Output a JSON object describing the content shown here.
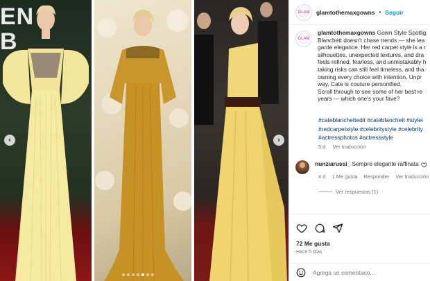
{
  "post": {
    "username": "glamtothemaxgowns",
    "separator": "•",
    "follow_label": "Seguir",
    "avatar_text": "GLAM"
  },
  "media": {
    "overlay_text_line1": "EN",
    "overlay_text_line2": "B",
    "prev_arrow": "‹",
    "next_arrow": "›",
    "dots_count": 7,
    "active_dot": 4
  },
  "caption": {
    "username": "glamtothemaxgowns",
    "text": " Gown Style Spotlig\nBlanchett doesn't chase trends — she lea\ngarde elegance. Her red carpet style is a r\nsilhouettes, unexpected textures, and dra\nfeels refined, fearless, and unmistakably h\ntaking risks can still feel timeless, and tha\nowning every choice with intention. Unpr\nway, Cate is couture personified.\nScroll through to see some of her best re\nyears — which one's your fave?",
    "hashtags": "#cateblanchettedit #cateblanchett #stylei\n#redcarpetstyle #celebritystyle #celebrity\n#actressphotos #actressstyle",
    "age": "5 d",
    "translate_label": "Ver traducción"
  },
  "comment": {
    "username": "nunziarussi_",
    "text": " Sempre elegante raffinata",
    "age": "4 d",
    "likes": "1 Me gusta",
    "reply_label": "Responder",
    "translate_label": "Ver traducción",
    "replies_label": "Ver respuestas (1)"
  },
  "actions": {
    "likes_label": "72 Me gusta",
    "time_label": "Hace 5 días",
    "comment_placeholder": "Agrega un comentario..."
  },
  "icons": [
    "heart-icon",
    "comment-icon",
    "share-icon",
    "emoji-icon"
  ],
  "colors": {
    "link_blue": "#0095f6",
    "hashtag_blue": "#00376b",
    "muted": "#737373",
    "text": "#262626"
  }
}
